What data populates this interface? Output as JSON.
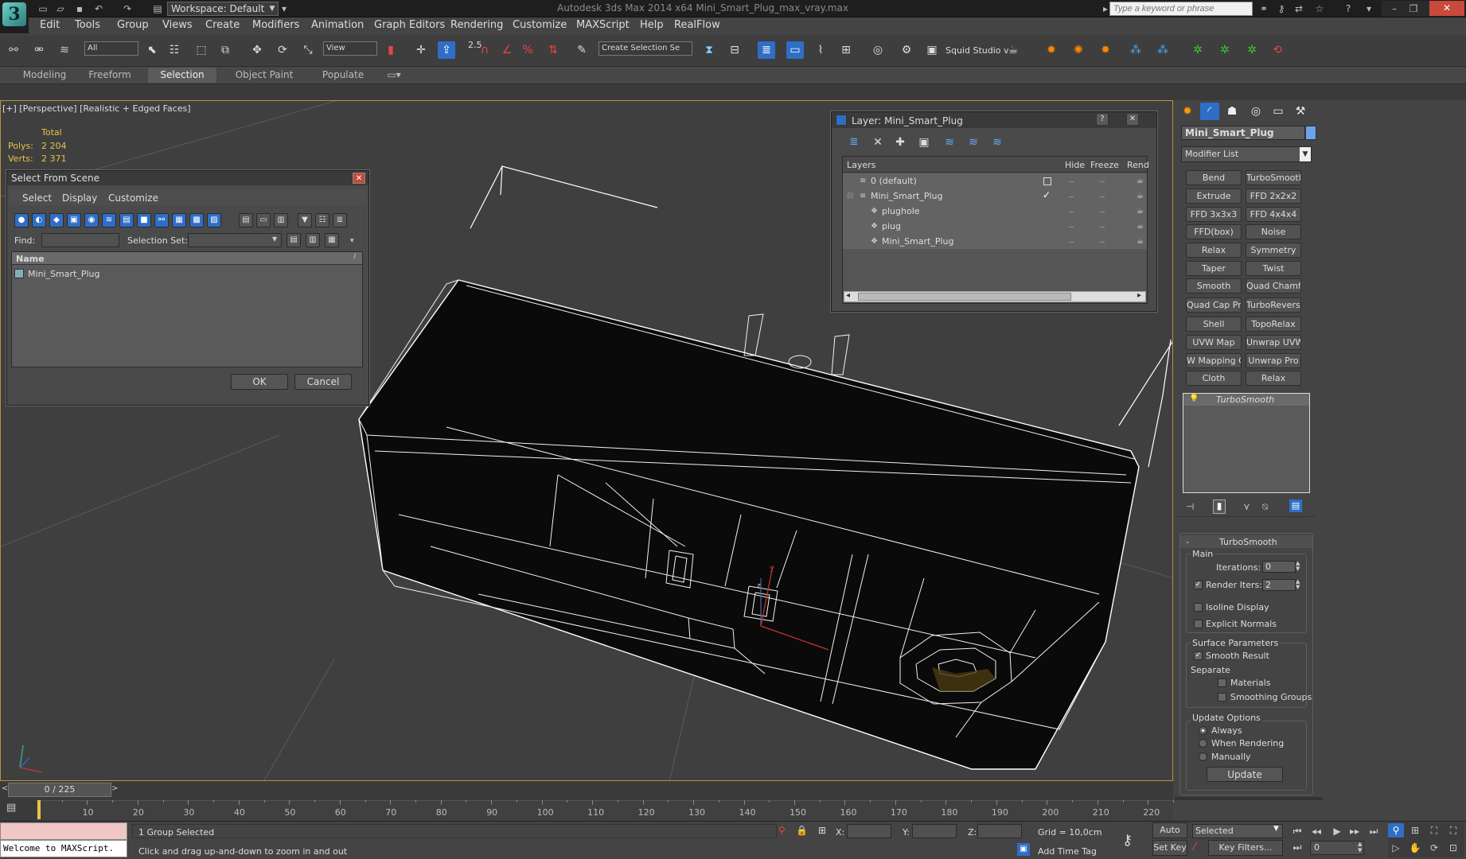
{
  "app": {
    "title": "Autodesk 3ds Max  2014 x64     Mini_Smart_Plug_max_vray.max",
    "workspace": "Workspace: Default",
    "search_placeholder": "Type a keyword or phrase"
  },
  "menu": [
    "Edit",
    "Tools",
    "Group",
    "Views",
    "Create",
    "Modifiers",
    "Animation",
    "Graph Editors",
    "Rendering",
    "Customize",
    "MAXScript",
    "Help",
    "RealFlow"
  ],
  "toolbar": {
    "selection_filter": "All",
    "ref_coord": "View",
    "snap_value": "2.5",
    "named_selection": "Create Selection Se",
    "studio": "Squid Studio v"
  },
  "ribbon_tabs": [
    "Modeling",
    "Freeform",
    "Selection",
    "Object Paint",
    "Populate"
  ],
  "ribbon_active": "Selection",
  "viewport": {
    "label": "[+] [Perspective] [Realistic + Edged Faces]",
    "stats_header": "Total",
    "polys_label": "Polys:",
    "polys_value": "2 204",
    "verts_label": "Verts:",
    "verts_value": "2 371"
  },
  "select_from_scene": {
    "title": "Select From Scene",
    "menu": [
      "Select",
      "Display",
      "Customize"
    ],
    "find_label": "Find:",
    "selection_set_label": "Selection Set:",
    "column_name": "Name",
    "items": [
      "Mini_Smart_Plug"
    ],
    "ok": "OK",
    "cancel": "Cancel"
  },
  "layer_dialog": {
    "title": "Layer: Mini_Smart_Plug",
    "columns": [
      "Layers",
      "Hide",
      "Freeze",
      "Rend"
    ],
    "rows": [
      {
        "name": "0 (default)",
        "indent": 0
      },
      {
        "name": "Mini_Smart_Plug",
        "indent": 0
      },
      {
        "name": "plughole",
        "indent": 1
      },
      {
        "name": "piug",
        "indent": 1
      },
      {
        "name": "Mini_Smart_Plug",
        "indent": 1
      }
    ]
  },
  "command_panel": {
    "object_name": "Mini_Smart_Plug",
    "modifier_list": "Modifier List",
    "modifiers": [
      "Bend",
      "TurboSmooth",
      "Extrude",
      "FFD 2x2x2",
      "FFD 3x3x3",
      "FFD 4x4x4",
      "FFD(box)",
      "Noise",
      "Relax",
      "Symmetry",
      "Taper",
      "Twist",
      "Smooth",
      "Quad Chamfer",
      "Quad Cap Pro",
      "TurboReverse",
      "Shell",
      "TopoRelax",
      "UVW Map",
      "Unwrap UVW",
      "W Mapping Cle",
      "Unwrap Pro",
      "Cloth",
      "Relax"
    ],
    "stack_item": "TurboSmooth",
    "rollout_title": "TurboSmooth",
    "main_label": "Main",
    "iterations_label": "Iterations:",
    "iterations_value": "0",
    "render_iters_label": "Render Iters:",
    "render_iters_value": "2",
    "isoline_label": "Isoline Display",
    "explicit_normals_label": "Explicit Normals",
    "surface_params_label": "Surface Parameters",
    "smooth_result_label": "Smooth Result",
    "separate_label": "Separate",
    "materials_label": "Materials",
    "smoothing_groups_label": "Smoothing Groups",
    "update_options_label": "Update Options",
    "always_label": "Always",
    "when_rendering_label": "When Rendering",
    "manually_label": "Manually",
    "update_button": "Update"
  },
  "timeline": {
    "frame": "0 / 225",
    "ticks": [
      "10",
      "20",
      "30",
      "40",
      "50",
      "60",
      "70",
      "80",
      "90",
      "100",
      "110",
      "120",
      "130",
      "140",
      "150",
      "160",
      "170",
      "180",
      "190",
      "200",
      "210",
      "220"
    ]
  },
  "status": {
    "maxscript": "Welcome to MAXScript.",
    "selected": "1 Group Selected",
    "prompt": "Click and drag up-and-down to zoom in and out",
    "x_label": "X:",
    "y_label": "Y:",
    "z_label": "Z:",
    "grid": "Grid = 10,0cm",
    "add_time_tag": "Add Time Tag",
    "auto_key": "Auto Key",
    "set_key": "Set Key",
    "key_mode": "Selected",
    "key_filters": "Key Filters...",
    "current_frame": "0"
  },
  "colors": {
    "viewport_border": "#b8943b",
    "stats": "#e8c34a",
    "accent_blue": "#2f6ec7"
  }
}
